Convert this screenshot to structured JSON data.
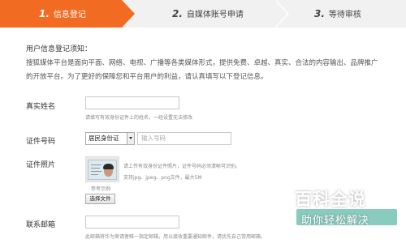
{
  "steps": [
    {
      "num": "1.",
      "label": "信息登记",
      "active": true
    },
    {
      "num": "2.",
      "label": "自媒体账号申请",
      "active": false
    },
    {
      "num": "3.",
      "label": "等待审核",
      "active": false
    }
  ],
  "notice": {
    "title": "用户信息登记须知：",
    "body": "搜狐媒体平台是面向平面、网络、电视、广播等各类媒体形式，提供免费、卓越、真实、合法的内容输出、品牌推广的开放平台。为了更好的保障您和平台用户的利益，请认真填写以下登记信息。"
  },
  "form": {
    "name": {
      "label": "真实姓名",
      "value": "",
      "hint": "请填写有效身份证件上的姓名，一经设置无法修改"
    },
    "id": {
      "label": "证件号码",
      "select_value": "居民身份证",
      "placeholder": "输入号码"
    },
    "photo": {
      "label": "证件照片",
      "hint_line1": "请上传有效身份证件照片，证件号码必须清晰可识别。",
      "hint_line2": "支持jpg、jpeg、png文件，最大5M",
      "sample_caption": "参考示例",
      "button": "选择文件"
    },
    "email": {
      "label": "联系邮箱",
      "value": "",
      "hint": "此邮箱将作为审请者唯一指定邮箱，用以接收重要通知邮件，请优先自己常用邮箱。"
    }
  },
  "watermark": {
    "top": "百科全说",
    "bottom": "助你轻松解决"
  },
  "colors": {
    "accent": "#f26b22",
    "bar": "#f1f1f1"
  }
}
